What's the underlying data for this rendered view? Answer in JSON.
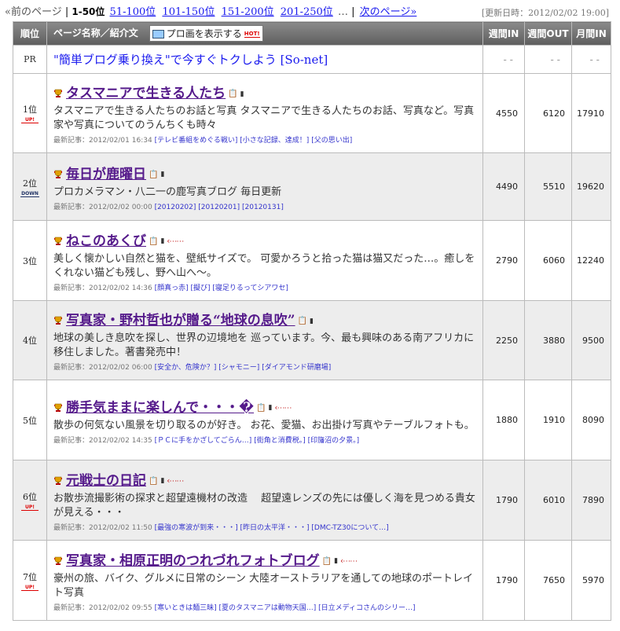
{
  "pager": {
    "prev": "«前のページ",
    "sep": "|",
    "current": "1-50位",
    "links": [
      "51-100位",
      "101-150位",
      "151-200位",
      "201-250位"
    ],
    "ellipsis": "…",
    "next": "次のページ»"
  },
  "updated": "[更新日時：2012/02/02 19:00]",
  "header": {
    "rank": "順位",
    "name": "ページ名称／紹介文",
    "profile_button": "プロ画を表示する",
    "hot": "HOT!",
    "week_in": "週間IN",
    "week_out": "週間OUT",
    "month_in": "月間IN"
  },
  "pr": {
    "label": "PR",
    "text": "\"簡単ブログ乗り換え\"で今すぐトクしよう [So-net]",
    "week_in": "- -",
    "week_out": "- -",
    "month_in": "- -"
  },
  "labels": {
    "latest": "最新記事：",
    "up": "UP!",
    "down": "DOWN"
  },
  "icons": {
    "trophy": "trophy-icon",
    "doc": "document-icon",
    "mobile": "mobile-phone-icon",
    "arrow": "arrow-icon"
  },
  "colors": {
    "header_bg": "#6e6e6e",
    "title_link": "#551a8b",
    "link": "#1a1aee",
    "up_badge": "#dd0000",
    "down_badge": "#223366",
    "row_alt_bg": "#ededed"
  },
  "rows": [
    {
      "rank": "1位",
      "move": "up",
      "title": "タスマニアで生きる人たち",
      "has_arrow": false,
      "desc": "タスマニアで生きる人たちのお話と写真 タスマニアで生きる人たちのお話、写真など。写真家や写真についてのうんちくも時々",
      "date": "2012/02/01 16:34",
      "articles": [
        "[テレビ番組をめぐる戦い]",
        "[小さな記録、達成！]",
        "[父の思い出]"
      ],
      "week_in": "4550",
      "week_out": "6120",
      "month_in": "17910"
    },
    {
      "rank": "2位",
      "move": "down",
      "title": "毎日が鹿曜日",
      "has_arrow": false,
      "desc": "プロカメラマン・八二一の鹿写真ブログ 毎日更新",
      "date": "2012/02/02 00:00",
      "articles": [
        "[20120202]",
        "[20120201]",
        "[20120131]"
      ],
      "week_in": "4490",
      "week_out": "5510",
      "month_in": "19620"
    },
    {
      "rank": "3位",
      "move": "",
      "title": "ねこのあくび",
      "has_arrow": true,
      "desc": "美しく懐かしい自然と猫を、壁紙サイズで。 可愛かろうと拾った猫は猫又だった…。癒しをくれない猫ども残し、野へ山へ～。",
      "date": "2012/02/02 14:36",
      "articles": [
        "[顔真っ赤]",
        "[擬び]",
        "[寝足りるってシアワセ]"
      ],
      "week_in": "2790",
      "week_out": "6060",
      "month_in": "12240"
    },
    {
      "rank": "4位",
      "move": "",
      "title": "写真家・野村哲也が贈る“地球の息吹”",
      "has_arrow": false,
      "desc": "地球の美しき息吹を探し、世界の辺境地を 巡っています。今、最も興味のある南アフリカに移住しました。著書発売中！",
      "date": "2012/02/02 06:00",
      "articles": [
        "[安全か、危険か？]",
        "[シャモニー]",
        "[ダイアモンド研磨場]"
      ],
      "week_in": "2250",
      "week_out": "3880",
      "month_in": "9500"
    },
    {
      "rank": "5位",
      "move": "",
      "title": "勝手気ままに楽しんで・・・�",
      "has_arrow": true,
      "desc": "散歩の何気ない風景を切り取るのが好き。 お花、愛猫、お出掛け写真やテーブルフォトも。",
      "date": "2012/02/02 14:35",
      "articles": [
        "[ＰＣに手をかざしてごらん…]",
        "[街角と消費税。]",
        "[印旛沼の夕景。]"
      ],
      "week_in": "1880",
      "week_out": "1910",
      "month_in": "8090"
    },
    {
      "rank": "6位",
      "move": "up",
      "title": "元戦士の日記",
      "has_arrow": true,
      "desc": "お散歩流撮影術の探求と超望遠機材の改造　 超望遠レンズの先には優しく海を見つめる貴女が見える・・・",
      "date": "2012/02/02 11:50",
      "articles": [
        "[最強の寒波が到来・・・]",
        "[昨日の太平洋・・・]",
        "[DMC-TZ30について…]"
      ],
      "week_in": "1790",
      "week_out": "6010",
      "month_in": "7890"
    },
    {
      "rank": "7位",
      "move": "up",
      "title": "写真家・相原正明のつれづれフォトブログ",
      "has_arrow": true,
      "desc": "豪州の旅、バイク、グルメに日常のシーン 大陸オーストラリアを通しての地球のポートレイト写真",
      "date": "2012/02/02 09:55",
      "articles": [
        "[寒いときは麺三昧]",
        "[夏のタスマニアは動物天国…]",
        "[日立メディコさんのシリー…]"
      ],
      "week_in": "1790",
      "week_out": "7650",
      "month_in": "5970"
    }
  ]
}
